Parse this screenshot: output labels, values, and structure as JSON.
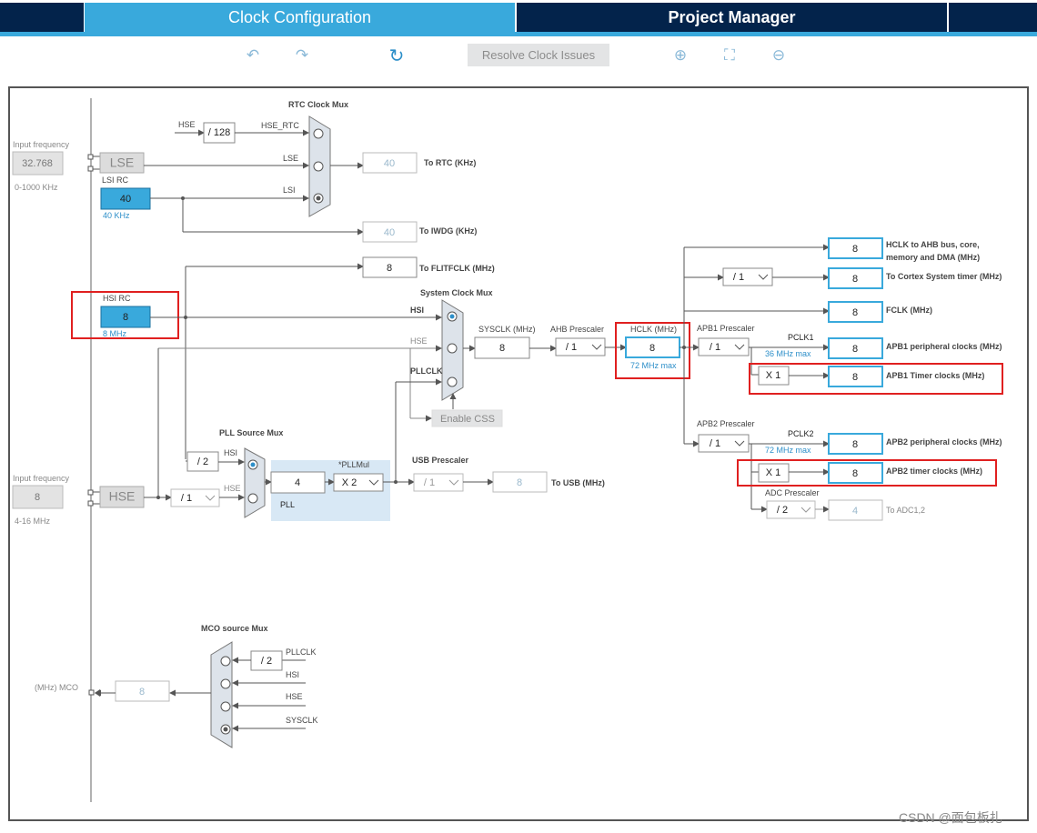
{
  "tabs": {
    "clock": "Clock Configuration",
    "project": "Project Manager"
  },
  "toolbar": {
    "resolve": "Resolve Clock Issues",
    "undo_icon": "↶",
    "redo_icon": "↷",
    "refresh_icon": "↻",
    "zoom_in_icon": "⊕",
    "fit_icon": "⛶",
    "zoom_out_icon": "⊖"
  },
  "lse": {
    "label": "LSE",
    "freq_label": "Input frequency",
    "freq": "32.768",
    "range": "0-1000 KHz"
  },
  "lsi": {
    "label": "LSI RC",
    "value": "40",
    "sub": "40 KHz"
  },
  "hsi": {
    "label": "HSI RC",
    "value": "8",
    "sub": "8 MHz"
  },
  "hse": {
    "label": "HSE",
    "freq_label": "Input frequency",
    "freq": "8",
    "range": "4-16 MHz",
    "div": "/ 1"
  },
  "rtc": {
    "title": "RTC Clock Mux",
    "in_hse": "HSE",
    "div": "/ 128",
    "hse_rtc": "HSE_RTC",
    "lse": "LSE",
    "lsi": "LSI",
    "out": "40",
    "out_label": "To RTC (KHz)"
  },
  "iwdg": {
    "out": "40",
    "label": "To IWDG (KHz)"
  },
  "flit": {
    "out": "8",
    "label": "To FLITFCLK (MHz)"
  },
  "sysmux": {
    "title": "System Clock Mux",
    "hsi": "HSI",
    "hse": "HSE",
    "pllclk": "PLLCLK",
    "css": "Enable CSS"
  },
  "sysclk": {
    "label": "SYSCLK (MHz)",
    "value": "8"
  },
  "ahb": {
    "label": "AHB Prescaler",
    "value": "/ 1"
  },
  "hclk": {
    "label": "HCLK (MHz)",
    "value": "8",
    "sub": "72 MHz max"
  },
  "apb1": {
    "label": "APB1 Prescaler",
    "value": "/ 1",
    "pclk": "PCLK1",
    "max": "36 MHz max",
    "timer_mul": "X 1"
  },
  "apb2": {
    "label": "APB2 Prescaler",
    "value": "/ 1",
    "pclk": "PCLK2",
    "max": "72 MHz max",
    "timer_mul": "X 1"
  },
  "adc": {
    "label": "ADC Prescaler",
    "value": "/ 2",
    "out": "4",
    "out_label": "To ADC1,2"
  },
  "outputs": {
    "hclk_ahb": {
      "value": "8",
      "label1": "HCLK to AHB bus, core,",
      "label2": "memory and DMA (MHz)"
    },
    "cortex": {
      "div": "/ 1",
      "value": "8",
      "label": "To Cortex System timer (MHz)"
    },
    "fclk": {
      "value": "8",
      "label": "FCLK (MHz)"
    },
    "apb1_periph": {
      "value": "8",
      "label": "APB1 peripheral clocks (MHz)"
    },
    "apb1_timer": {
      "value": "8",
      "label": "APB1 Timer clocks (MHz)"
    },
    "apb2_periph": {
      "value": "8",
      "label": "APB2 peripheral clocks (MHz)"
    },
    "apb2_timer": {
      "value": "8",
      "label": "APB2 timer clocks (MHz)"
    }
  },
  "pll": {
    "src_title": "PLL Source Mux",
    "hsi_div": "/ 2",
    "hsi": "HSI",
    "hse": "HSE",
    "value": "4",
    "mul_label": "*PLLMul",
    "mul": "X 2",
    "label": "PLL"
  },
  "usb": {
    "label": "USB Prescaler",
    "div": "/ 1",
    "out": "8",
    "out_label": "To USB (MHz)"
  },
  "mco": {
    "title": "MCO source Mux",
    "div": "/ 2",
    "pllclk": "PLLCLK",
    "hsi": "HSI",
    "hse": "HSE",
    "sysclk": "SYSCLK",
    "out": "8",
    "label": "(MHz) MCO"
  },
  "watermark": "CSDN @面包板扎"
}
